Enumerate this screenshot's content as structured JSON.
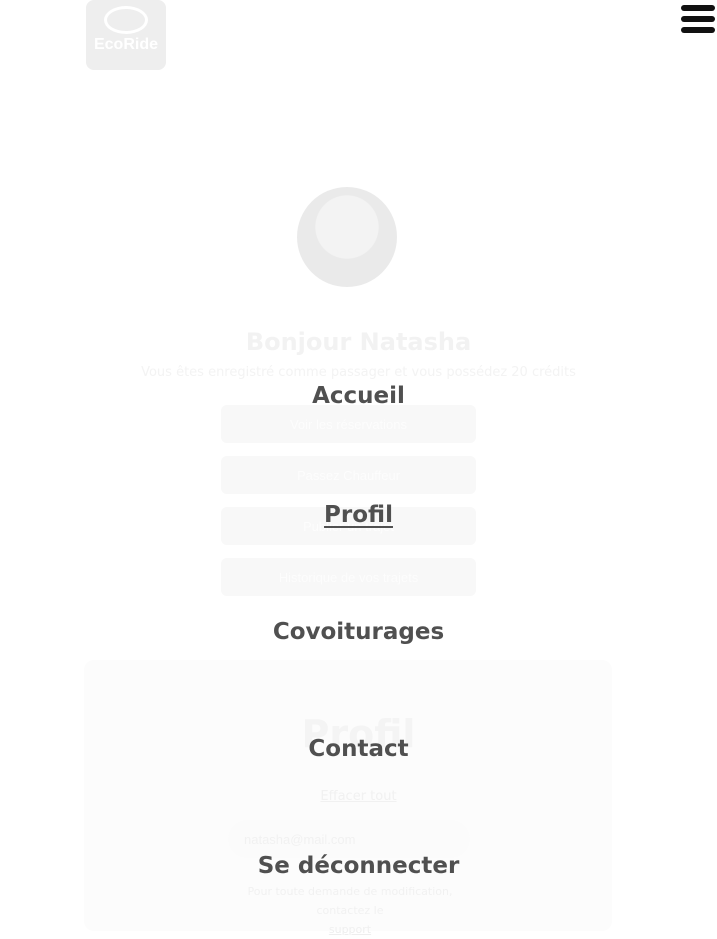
{
  "app": {
    "logo": {
      "label": "EcoRide",
      "icon": "car-leaf-logo"
    }
  },
  "profile": {
    "greeting": "Bonjour Natasha",
    "status": "Vous êtes enregistré comme passager et vous possédez 20 crédits",
    "actions": [
      "Voir les réservations",
      "Passez Chauffeur",
      "Publier un trajet",
      "Historique de vos trajets"
    ]
  },
  "profile_section": {
    "title": "Profil",
    "link": "Effacer tout",
    "email_value": "natasha@mail.com",
    "helper_text": "Pour toute demande de modification, contactez le",
    "support_link": "support"
  },
  "menu": {
    "items": [
      {
        "label": "Accueil",
        "active": false
      },
      {
        "label": "Profil",
        "active": true
      },
      {
        "label": "Covoiturages",
        "active": false
      },
      {
        "label": "Contact",
        "active": false
      },
      {
        "label": "Se déconnecter",
        "active": false
      }
    ],
    "toggle_icon": "menu-icon"
  },
  "colors": {
    "menu_text": "#505050",
    "menu_icon": "#111111",
    "faded_text": "#f0f0f0",
    "background": "#ffffff"
  }
}
